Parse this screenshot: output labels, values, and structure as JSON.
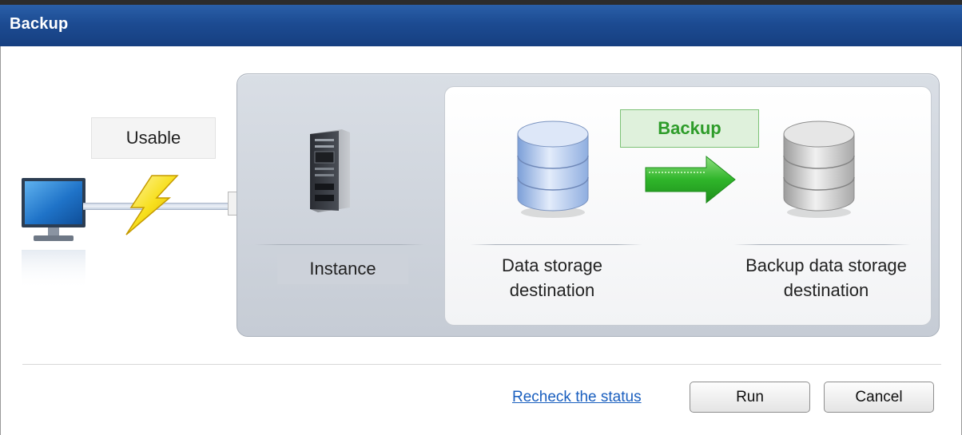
{
  "window": {
    "title": "Backup"
  },
  "client": {
    "status_label": "Usable"
  },
  "instance": {
    "label": "Instance"
  },
  "storage": {
    "source_label": "Data storage destination",
    "operation_label": "Backup",
    "target_label": "Backup data storage destination"
  },
  "actions": {
    "recheck_link": "Recheck the status",
    "run_label": "Run",
    "cancel_label": "Cancel"
  },
  "icons": {
    "client": "computer-monitor-icon",
    "connection": "lightning-bolt-icon",
    "server": "server-tower-icon",
    "source_db": "database-icon",
    "target_db": "database-icon",
    "transfer": "right-arrow-icon"
  },
  "colors": {
    "title_bar": "#1c4b92",
    "link": "#1a5fbf",
    "backup_accent": "#2e9c2a",
    "backup_badge_bg": "#dff1dc"
  }
}
